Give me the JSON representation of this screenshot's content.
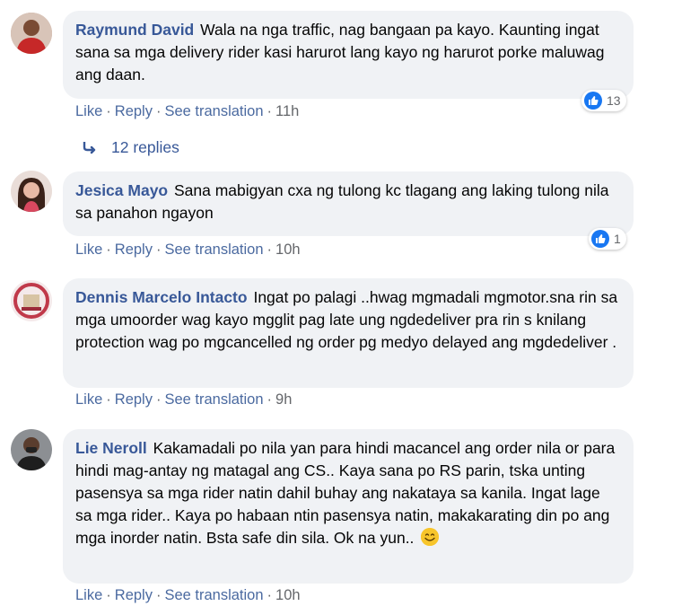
{
  "comments": [
    {
      "author": "Raymund David",
      "text": "Wala na nga traffic, nag bangaan pa kayo. Kaunting ingat sana sa mga delivery rider kasi harurot lang kayo ng harurot porke maluwag ang daan.",
      "like": "Like",
      "reply": "Reply",
      "translate": "See translation",
      "time": "11h",
      "reactions": "13"
    },
    {
      "author": "Jesica Mayo",
      "text": "Sana mabigyan cxa ng tulong kc tlagang ang laking tulong nila sa panahon ngayon",
      "like": "Like",
      "reply": "Reply",
      "translate": "See translation",
      "time": "10h",
      "reactions": "1"
    },
    {
      "author": "Dennis Marcelo Intacto",
      "text": "Ingat po palagi ..hwag mgmadali mgmotor.sna rin sa mga umoorder wag kayo mgglit pag late ung ngdedeliver pra rin s knilang protection wag po mgcancelled ng order pg medyo delayed ang mgdedeliver .",
      "like": "Like",
      "reply": "Reply",
      "translate": "See translation",
      "time": "9h"
    },
    {
      "author": "Lie Neroll",
      "text": "Kakamadali po nila yan para hindi macancel ang order nila or para hindi mag-antay ng matagal ang CS.. Kaya sana po RS parin, tska unting pasensya sa mga rider natin dahil buhay ang nakataya sa kanila. Ingat lage sa mga rider.. Kaya po habaan ntin pasensya natin, makakarating din po ang mga inorder natin. Bsta safe din sila. Ok na yun..",
      "like": "Like",
      "reply": "Reply",
      "translate": "See translation",
      "time": "10h"
    }
  ],
  "replies_label": "12 replies",
  "colors": {
    "bubble": "#f0f2f5",
    "author": "#385898",
    "meta": "#65676b",
    "like_blue": "#1877f2"
  }
}
